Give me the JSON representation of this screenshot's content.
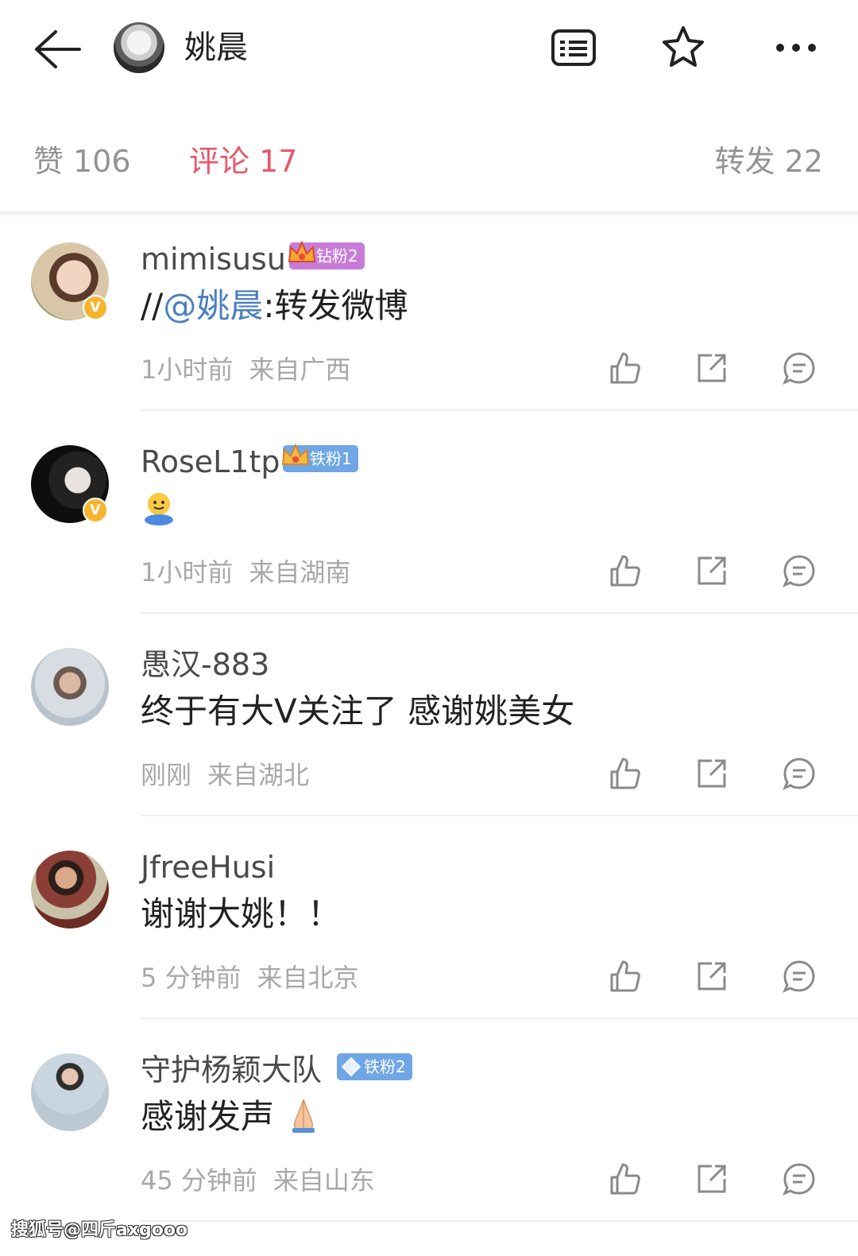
{
  "header": {
    "title": "姚晨",
    "icons": [
      "back-arrow-icon",
      "avatar",
      "list-icon",
      "star-icon",
      "more-icon"
    ]
  },
  "tabs": {
    "likes": "赞 106",
    "comments": "评论 17",
    "reposts": "转发 22"
  },
  "comments": [
    {
      "username": "mimisusu",
      "badge": "钻粉2",
      "badge_color": "#c77dd8",
      "text_prefix": "//",
      "mention": "@姚晨",
      "text_suffix": ":转发微博",
      "time": "1小时前",
      "location": "来自广西",
      "verified": "V"
    },
    {
      "username": "RoseL1tp",
      "badge": "铁粉1",
      "badge_color": "#6fa6e6",
      "text": "",
      "emoji": "hugging-emoji",
      "time": "1小时前",
      "location": "来自湖南",
      "verified": "V"
    },
    {
      "username": "愚汉-883",
      "text": "终于有大V关注了 感谢姚美女",
      "time": "刚刚",
      "location": "来自湖北"
    },
    {
      "username": "JfreeHusi",
      "text": "谢谢大姚！！",
      "time": "5 分钟前",
      "location": "来自北京"
    },
    {
      "username": "守护杨颖大队",
      "badge": "铁粉2",
      "badge_color": "#6fa6e6",
      "text": "感谢发声",
      "emoji": "pray-emoji",
      "time": "45 分钟前",
      "location": "来自山东"
    }
  ],
  "watermark": "搜狐号@四斤axgooo",
  "colors": {
    "accent": "#e8586a",
    "mention": "#4a7fc1",
    "muted": "#a8a8a8"
  }
}
